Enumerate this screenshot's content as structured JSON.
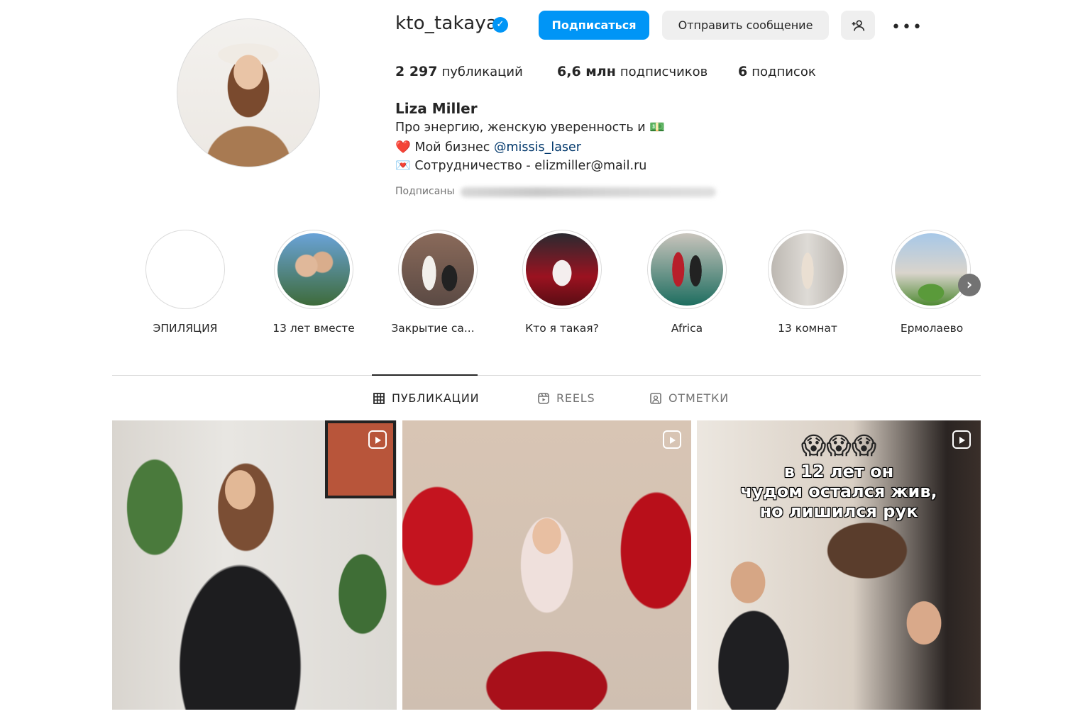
{
  "profile": {
    "username": "kto_takaya",
    "verified_glyph": "✓",
    "full_name": "Liza Miller",
    "bio_line1": "Про энергию, женскую уверенность и 💵",
    "bio_line2_prefix": "❤️ Мой бизнес ",
    "bio_line2_link": "@missis_laser",
    "bio_line3": "💌 Сотрудничество - elizmiller@mail.ru",
    "followed_by_label": "Подписаны"
  },
  "buttons": {
    "follow": "Подписаться",
    "message": "Отправить сообщение",
    "more": "•••"
  },
  "stats": {
    "posts_count": "2 297",
    "posts_label": "публикаций",
    "followers_count": "6,6 млн",
    "followers_label": "подписчиков",
    "following_count": "6",
    "following_label": "подписок"
  },
  "highlights": [
    {
      "label": "ЭПИЛЯЦИЯ"
    },
    {
      "label": "13 лет вместе"
    },
    {
      "label": "Закрытие са..."
    },
    {
      "label": "Кто я такая?"
    },
    {
      "label": "Africa"
    },
    {
      "label": "13 комнат"
    },
    {
      "label": "Ермолаево"
    }
  ],
  "tabs": [
    {
      "label": "ПУБЛИКАЦИИ",
      "icon": "grid-icon",
      "active": true
    },
    {
      "label": "REELS",
      "icon": "reels-icon",
      "active": false
    },
    {
      "label": "ОТМЕТКИ",
      "icon": "tagged-icon",
      "active": false
    }
  ],
  "posts": [
    {
      "type": "reel"
    },
    {
      "type": "reel"
    },
    {
      "type": "reel",
      "overlay_emoji": "😱😱😱",
      "overlay_text_1": "в 12 лет он",
      "overlay_text_2": "чудом остался жив,",
      "overlay_text_3": "но лишился рук"
    }
  ],
  "colors": {
    "accent_blue": "#0095f6",
    "link_blue": "#00376b",
    "secondary_button": "#efefef",
    "text": "#262626",
    "muted": "#737373"
  }
}
